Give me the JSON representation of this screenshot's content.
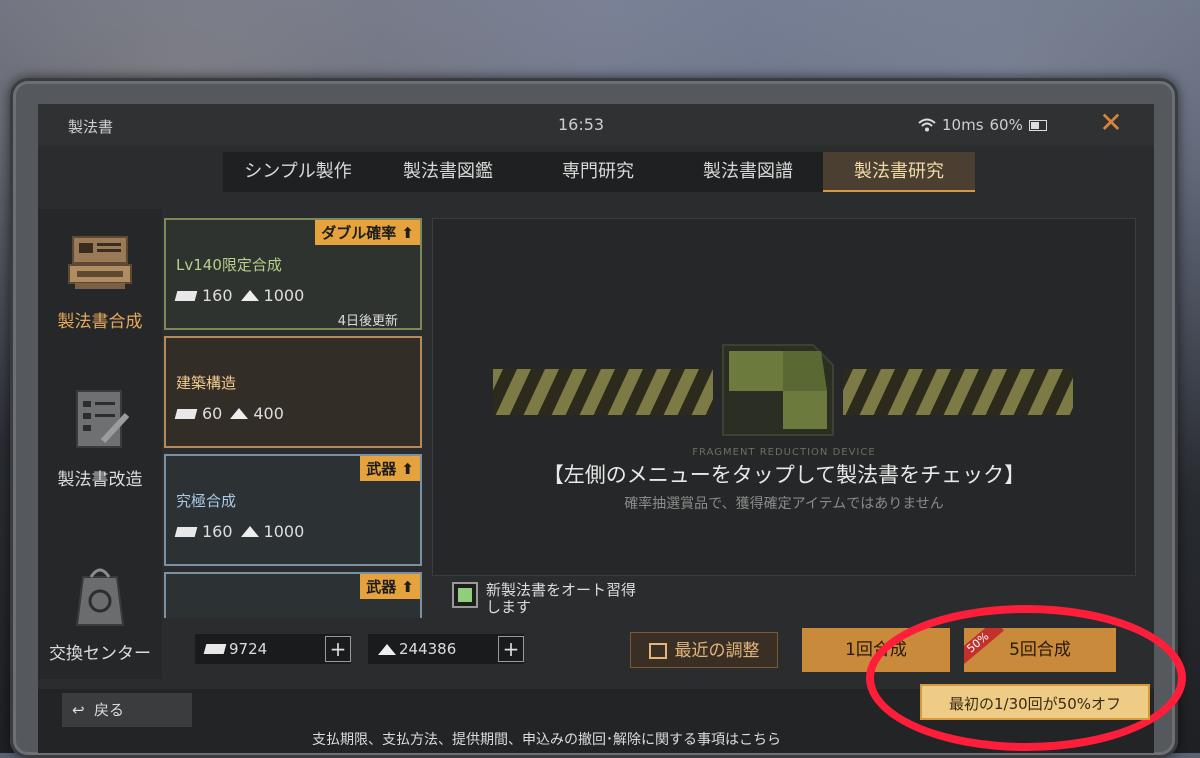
{
  "window": {
    "title": "製法書",
    "clock": "16:53",
    "ping": "10ms",
    "battery": "60%"
  },
  "tabs": [
    {
      "label": "シンプル製作",
      "active": false
    },
    {
      "label": "製法書図鑑",
      "active": false
    },
    {
      "label": "専門研究",
      "active": false
    },
    {
      "label": "製法書図譜",
      "active": false
    },
    {
      "label": "製法書研究",
      "active": true
    }
  ],
  "nav": [
    {
      "label": "製法書合成",
      "active": true,
      "icon": "synthesis-icon"
    },
    {
      "label": "製法書改造",
      "active": false,
      "icon": "modify-icon"
    },
    {
      "label": "交換センター",
      "active": false,
      "icon": "exchange-icon"
    }
  ],
  "cards": [
    {
      "tag": "ダブル確率",
      "name": "Lv140限定合成",
      "ticket": "160",
      "gold": "1000",
      "refresh": "4日後更新"
    },
    {
      "tag": "",
      "name": "建築構造",
      "ticket": "60",
      "gold": "400",
      "refresh": ""
    },
    {
      "tag": "武器",
      "name": "究極合成",
      "ticket": "160",
      "gold": "1000",
      "refresh": ""
    },
    {
      "tag": "武器",
      "name": "",
      "ticket": "",
      "gold": "",
      "refresh": ""
    }
  ],
  "detail": {
    "device_caption": "FRAGMENT REDUCTION DEVICE",
    "hint_main": "【左側のメニューをタップして製法書をチェック】",
    "hint_sub": "確率抽選賞品で、獲得確定アイテムではありません"
  },
  "auto_learn": {
    "label_line1": "新製法書をオート習得",
    "label_line2": "します",
    "checked": true
  },
  "currency": {
    "tickets": "9724",
    "gold": "244386"
  },
  "buttons": {
    "recent": "最近の調整",
    "single": "1回合成",
    "five": "5回合成",
    "five_badge": "50%",
    "promo": "最初の1/30回が50%オフ"
  },
  "footer": {
    "back": "戻る",
    "legal": "支払期限、支払方法、提供期間、申込みの撤回･解除に関する事項はこちら"
  },
  "colors": {
    "accent": "#d69a46",
    "promo_bg": "#efcc85",
    "highlight_circle": "#ff1e3a"
  }
}
